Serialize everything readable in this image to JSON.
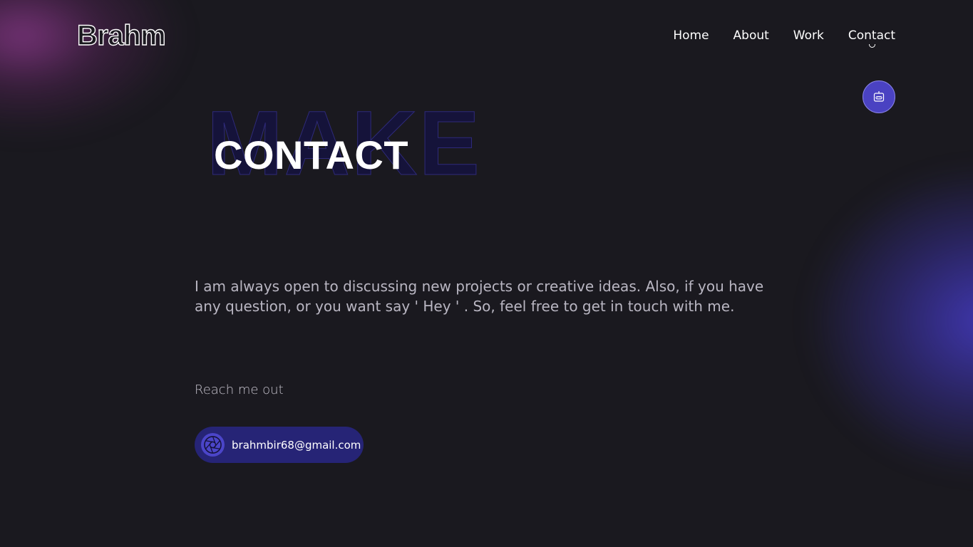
{
  "brand": {
    "logo_text": "Brahm"
  },
  "nav": {
    "items": [
      {
        "label": "Home"
      },
      {
        "label": "About"
      },
      {
        "label": "Work"
      },
      {
        "label": "Contact",
        "active": true
      }
    ]
  },
  "hero": {
    "background_word": "MAKE",
    "title": "CONTACT"
  },
  "content": {
    "intro": "I am always open to discussing new projects or creative ideas. Also, if you have any question, or you want say ' Hey ' . So, feel free to get in touch with me.",
    "reach_label": "Reach me out",
    "email": "brahmbir68@gmail.com"
  },
  "icons": {
    "bot_button": "robot-icon",
    "email_badge": "aperture-icon"
  },
  "colors": {
    "background": "#1a191f",
    "accent": "#4a42c2",
    "email_pill": "#262476",
    "glow_pink": "#963c96",
    "glow_blue": "#463cc8"
  }
}
